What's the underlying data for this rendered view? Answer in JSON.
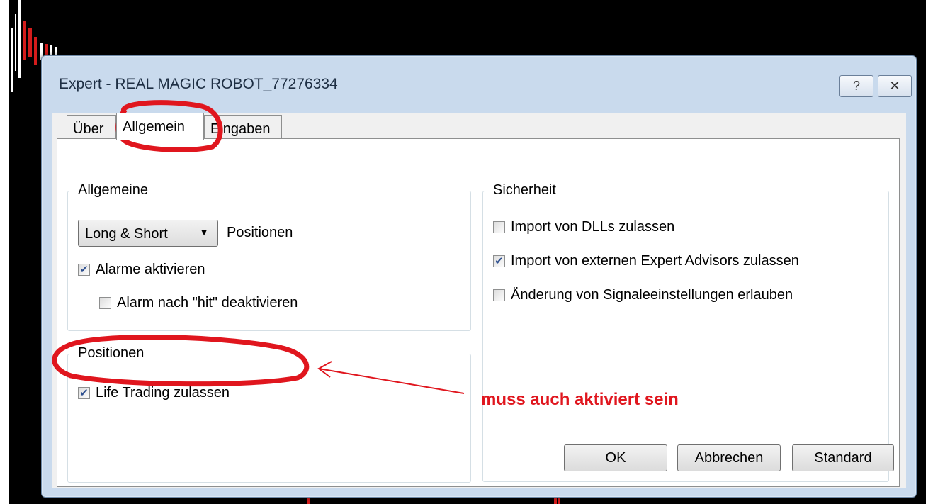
{
  "window": {
    "title": "Expert - REAL MAGIC ROBOT_77276334",
    "help_icon": "?",
    "close_icon": "✕"
  },
  "tabs": [
    {
      "label": "Über"
    },
    {
      "label": "Allgemein"
    },
    {
      "label": "Eingaben"
    }
  ],
  "groups": {
    "allgemeine": {
      "title": "Allgemeine",
      "dropdown_value": "Long & Short",
      "dropdown_suffix": "Positionen",
      "alarme_label": "Alarme aktivieren",
      "alarme_checked": true,
      "alarm_hit_label": "Alarm nach \"hit\" deaktivieren",
      "alarm_hit_checked": false
    },
    "positionen": {
      "title": "Positionen",
      "live_label": "Life Trading zulassen",
      "live_checked": true
    },
    "sicherheit": {
      "title": "Sicherheit",
      "items": [
        {
          "label": "Import von DLLs zulassen",
          "checked": false
        },
        {
          "label": "Import von externen Expert Advisors zulassen",
          "checked": true
        },
        {
          "label": "Änderung von Signaleeinstellungen erlauben",
          "checked": false
        }
      ]
    }
  },
  "buttons": {
    "ok": "OK",
    "cancel": "Abbrechen",
    "default": "Standard"
  },
  "annotation": {
    "text": "muss auch aktiviert sein",
    "color": "#e0161e"
  }
}
